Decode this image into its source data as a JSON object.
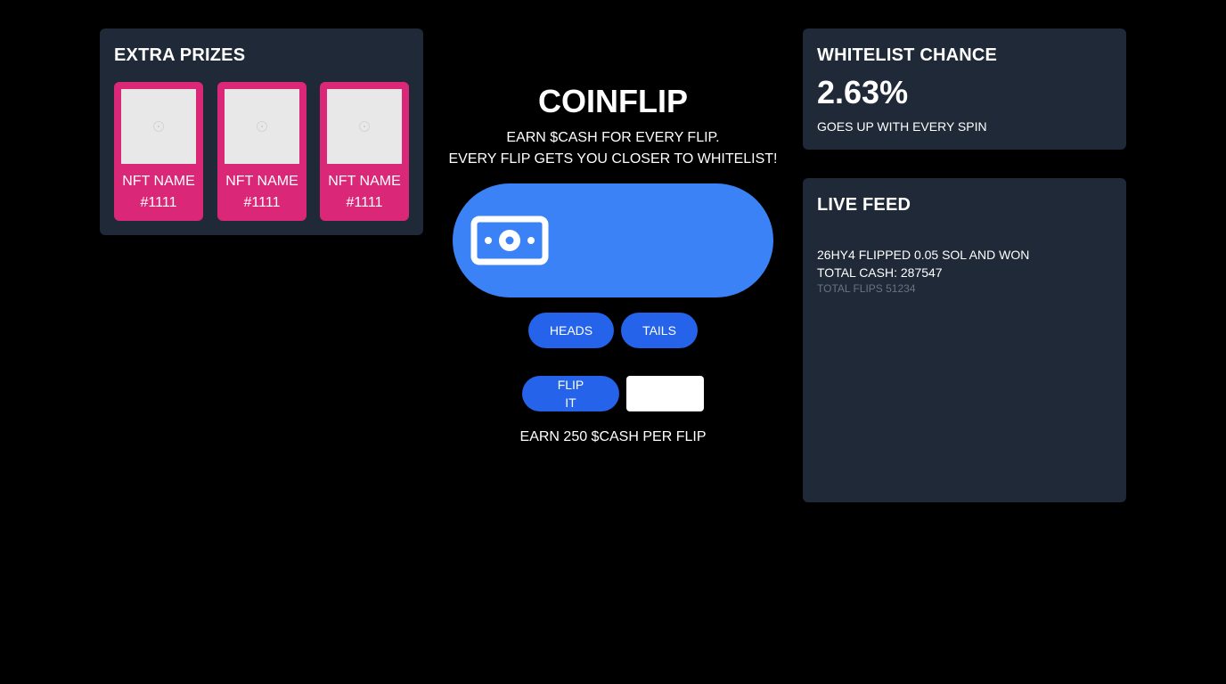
{
  "extra_prizes": {
    "title": "EXTRA PRIZES",
    "items": [
      {
        "name": "NFT NAME",
        "number": "#1111"
      },
      {
        "name": "NFT NAME",
        "number": "#1111"
      },
      {
        "name": "NFT NAME",
        "number": "#1111"
      }
    ]
  },
  "coinflip": {
    "title": "COINFLIP",
    "subtitle_1": "EARN $CASH FOR EVERY FLIP.",
    "subtitle_2": "EVERY FLIP GETS YOU CLOSER TO WHITELIST!",
    "coin_icon": "cash-icon",
    "heads_label": "HEADS",
    "tails_label": "TAILS",
    "flip_label": "FLIP IT",
    "amount_value": "",
    "earn_text": "EARN 250 $CASH PER FLIP"
  },
  "whitelist": {
    "title": "WHITELIST CHANCE",
    "percent": "2.63%",
    "note": "GOES UP WITH EVERY SPIN"
  },
  "live_feed": {
    "title": "LIVE FEED",
    "entries": [
      {
        "text": "26HY4 FLIPPED 0.05 SOL AND WON",
        "total_cash": "TOTAL CASH: 287547",
        "total_flips": "TOTAL FLIPS 51234"
      }
    ]
  },
  "colors": {
    "background": "#000000",
    "panel": "#1f2937",
    "prize_card": "#db2777",
    "coin_pill": "#3b82f6",
    "button": "#2563eb",
    "muted_text": "#6b7280"
  }
}
